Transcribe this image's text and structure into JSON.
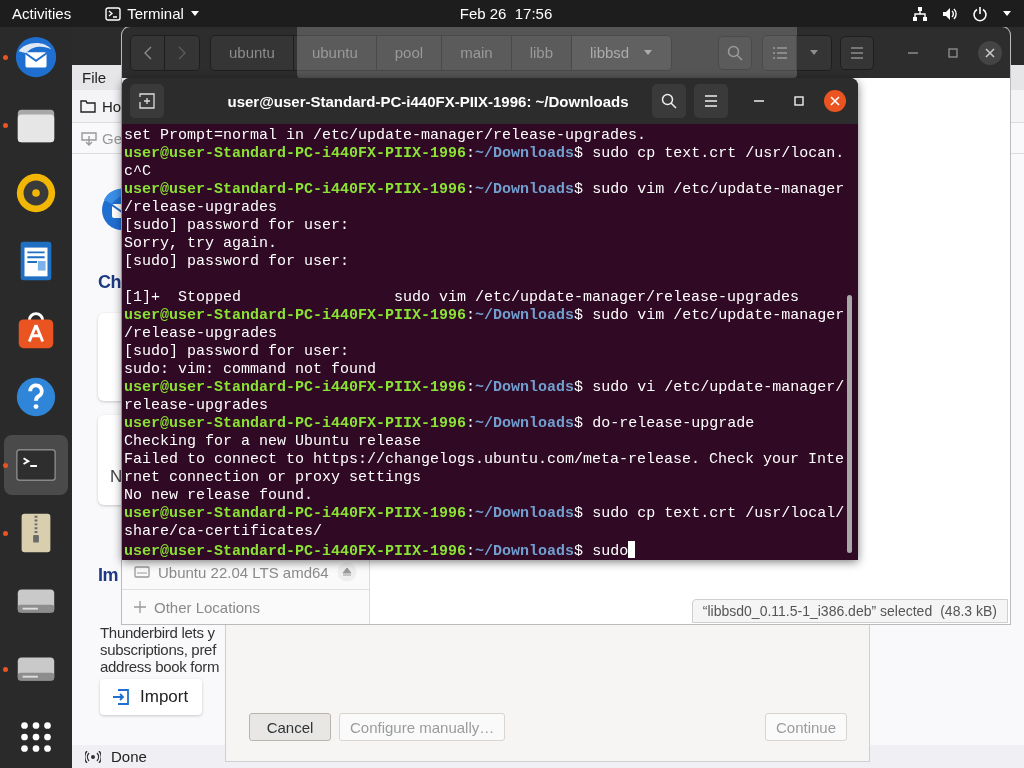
{
  "top_bar": {
    "activities": "Activities",
    "app_menu": "Terminal",
    "clock": "Feb 26  17:56"
  },
  "dock": {
    "items": [
      {
        "kind": "mail",
        "running": true,
        "selected": false
      },
      {
        "kind": "files",
        "running": true,
        "selected": false
      },
      {
        "kind": "music",
        "running": false,
        "selected": false
      },
      {
        "kind": "document",
        "running": false,
        "selected": false
      },
      {
        "kind": "store",
        "running": false,
        "selected": false
      },
      {
        "kind": "help",
        "running": false,
        "selected": false
      },
      {
        "kind": "terminal",
        "running": true,
        "selected": true
      },
      {
        "kind": "archive",
        "running": true,
        "selected": false
      },
      {
        "kind": "drive",
        "running": false,
        "selected": false
      },
      {
        "kind": "drive",
        "running": true,
        "selected": false
      },
      {
        "kind": "apps",
        "running": false,
        "selected": false
      }
    ]
  },
  "mail_window": {
    "menu": "File",
    "tab": "Ho",
    "toolbar_item": "Ge",
    "heading_1": "Ch",
    "card_text": "N",
    "heading_2": "Im",
    "paragraph": [
      "Thunderbird lets y",
      "subscriptions, pref",
      "address book form"
    ],
    "import_button": "Import",
    "status": "Done"
  },
  "dialog": {
    "buttons": [
      {
        "label": "Cancel",
        "disabled": false
      },
      {
        "label": "Configure manually…",
        "disabled": true
      },
      {
        "label": "Continue",
        "disabled": true
      }
    ]
  },
  "files_window": {
    "path": [
      {
        "label": "ubuntu",
        "selected": false
      },
      {
        "label": "ubuntu",
        "selected": false
      },
      {
        "label": "pool",
        "selected": false
      },
      {
        "label": "main",
        "selected": false
      },
      {
        "label": "libb",
        "selected": false
      },
      {
        "label": "libbsd",
        "selected": true
      }
    ],
    "sidebar": [
      {
        "kind": "drive",
        "label": "Ubuntu 22.04 LTS amd64"
      },
      {
        "kind": "other",
        "label": "Other Locations"
      }
    ],
    "status": "“libbsd0_0.11.5-1_i386.deb” selected",
    "status_size": "(48.3 kB)"
  },
  "terminal": {
    "title": "user@user-Standard-PC-i440FX-PIIX-1996: ~/Downloads",
    "lines": [
      {
        "kind": "output",
        "text": "set Prompt=normal in /etc/update-manager/release-upgrades."
      },
      {
        "kind": "prompt",
        "user": "user@user-Standard-PC-i440FX-PIIX-1996",
        "colon": ":",
        "path": "~/Downloads",
        "dollar": "$ ",
        "command": "sudo cp text.crt /usr/locan."
      },
      {
        "kind": "output",
        "text": "c^C"
      },
      {
        "kind": "prompt",
        "user": "user@user-Standard-PC-i440FX-PIIX-1996",
        "colon": ":",
        "path": "~/Downloads",
        "dollar": "$ ",
        "command": "sudo vim /etc/update-manager"
      },
      {
        "kind": "output",
        "text": "/release-upgrades"
      },
      {
        "kind": "output",
        "text": "[sudo] password for user:"
      },
      {
        "kind": "output",
        "text": "Sorry, try again."
      },
      {
        "kind": "output",
        "text": "[sudo] password for user:"
      },
      {
        "kind": "blank"
      },
      {
        "kind": "output",
        "text": "[1]+  Stopped                 sudo vim /etc/update-manager/release-upgrades"
      },
      {
        "kind": "prompt",
        "user": "user@user-Standard-PC-i440FX-PIIX-1996",
        "colon": ":",
        "path": "~/Downloads",
        "dollar": "$ ",
        "command": "sudo vim /etc/update-manager"
      },
      {
        "kind": "output",
        "text": "/release-upgrades"
      },
      {
        "kind": "output",
        "text": "[sudo] password for user:"
      },
      {
        "kind": "output",
        "text": "sudo: vim: command not found"
      },
      {
        "kind": "prompt",
        "user": "user@user-Standard-PC-i440FX-PIIX-1996",
        "colon": ":",
        "path": "~/Downloads",
        "dollar": "$ ",
        "command": "sudo vi /etc/update-manager/"
      },
      {
        "kind": "output",
        "text": "release-upgrades"
      },
      {
        "kind": "prompt",
        "user": "user@user-Standard-PC-i440FX-PIIX-1996",
        "colon": ":",
        "path": "~/Downloads",
        "dollar": "$ ",
        "command": "do-release-upgrade"
      },
      {
        "kind": "output",
        "text": "Checking for a new Ubuntu release"
      },
      {
        "kind": "output",
        "text": "Failed to connect to https://changelogs.ubuntu.com/meta-release. Check your Inte"
      },
      {
        "kind": "output",
        "text": "rnet connection or proxy settings"
      },
      {
        "kind": "output",
        "text": "No new release found."
      },
      {
        "kind": "prompt",
        "user": "user@user-Standard-PC-i440FX-PIIX-1996",
        "colon": ":",
        "path": "~/Downloads",
        "dollar": "$ ",
        "command": "sudo cp text.crt /usr/local/"
      },
      {
        "kind": "output",
        "text": "share/ca-certificates/"
      },
      {
        "kind": "prompt",
        "user": "user@user-Standard-PC-i440FX-PIIX-1996",
        "colon": ":",
        "path": "~/Downloads",
        "dollar": "$ ",
        "command": "sudo",
        "cursor": true
      }
    ]
  }
}
